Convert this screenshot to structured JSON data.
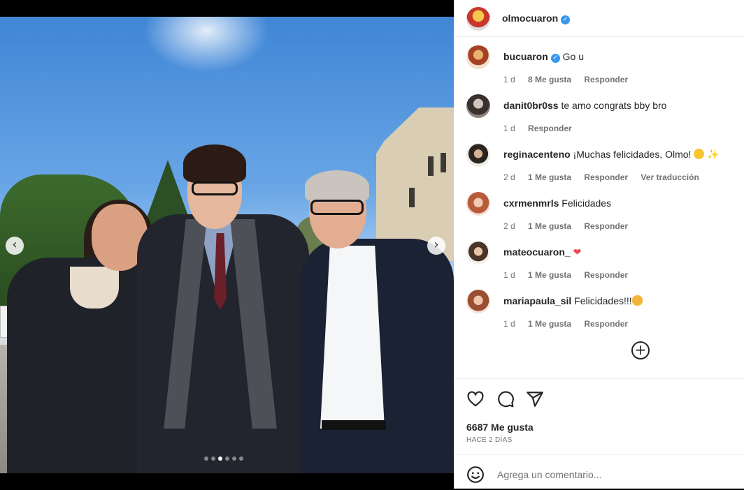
{
  "post": {
    "username": "olmocuaron",
    "verified": true,
    "carousel": {
      "total": 6,
      "active": 3
    }
  },
  "comments": [
    {
      "username": "bucuaron",
      "verified": true,
      "text": "Go u",
      "time": "1 d",
      "likes": "8 Me gusta",
      "reply": "Responder",
      "translate": ""
    },
    {
      "username": "danit0br0ss",
      "verified": false,
      "text": "te amo congrats bby bro",
      "time": "1 d",
      "likes": "",
      "reply": "Responder",
      "translate": ""
    },
    {
      "username": "reginacenteno",
      "verified": false,
      "text": "¡Muchas felicidades, Olmo!",
      "time": "2 d",
      "likes": "1 Me gusta",
      "reply": "Responder",
      "translate": "Ver traducción"
    },
    {
      "username": "cxrmenmrls",
      "verified": false,
      "text": "Felicidades",
      "time": "2 d",
      "likes": "1 Me gusta",
      "reply": "Responder",
      "translate": ""
    },
    {
      "username": "mateocuaron_",
      "verified": false,
      "text": "",
      "time": "1 d",
      "likes": "1 Me gusta",
      "reply": "Responder",
      "translate": ""
    },
    {
      "username": "mariapaula_sil",
      "verified": false,
      "text": "Felicidades!!!",
      "time": "1 d",
      "likes": "1 Me gusta",
      "reply": "Responder",
      "translate": ""
    }
  ],
  "icons": {
    "like": "heart-icon",
    "comment": "comment-icon",
    "share": "share-icon",
    "emoji": "smile-icon",
    "more": "plus-circle-icon",
    "prev": "chevron-left-icon",
    "next": "chevron-right-icon"
  },
  "stats": {
    "likes": "6687 Me gusta",
    "posted": "HACE 2 DÍAS"
  },
  "composer": {
    "placeholder": "Agrega un comentario..."
  },
  "colors": {
    "verified": "#3897f0",
    "heart": "#ed4956",
    "muted": "#737373"
  }
}
